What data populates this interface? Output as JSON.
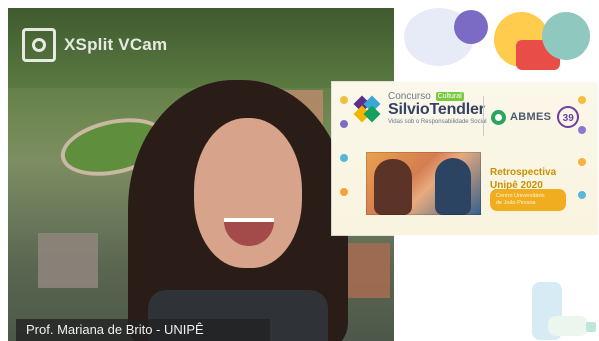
{
  "camera": {
    "logo_text": "XSplit VCam",
    "caption": "Prof. Mariana de Brito - UNIPÊ"
  },
  "banner": {
    "top_word": "Concurso",
    "tag": "Cultural",
    "main_name": "SilvioTendler",
    "tagline": "Vidas sob o Responsabilidade Social",
    "partner": "ABMES",
    "partner_badge": "39",
    "title_line1": "Retrospectiva",
    "title_line2": "Unipê 2020",
    "credit_line1": "Centro Universitário",
    "credit_line2": "de João Pessoa"
  }
}
